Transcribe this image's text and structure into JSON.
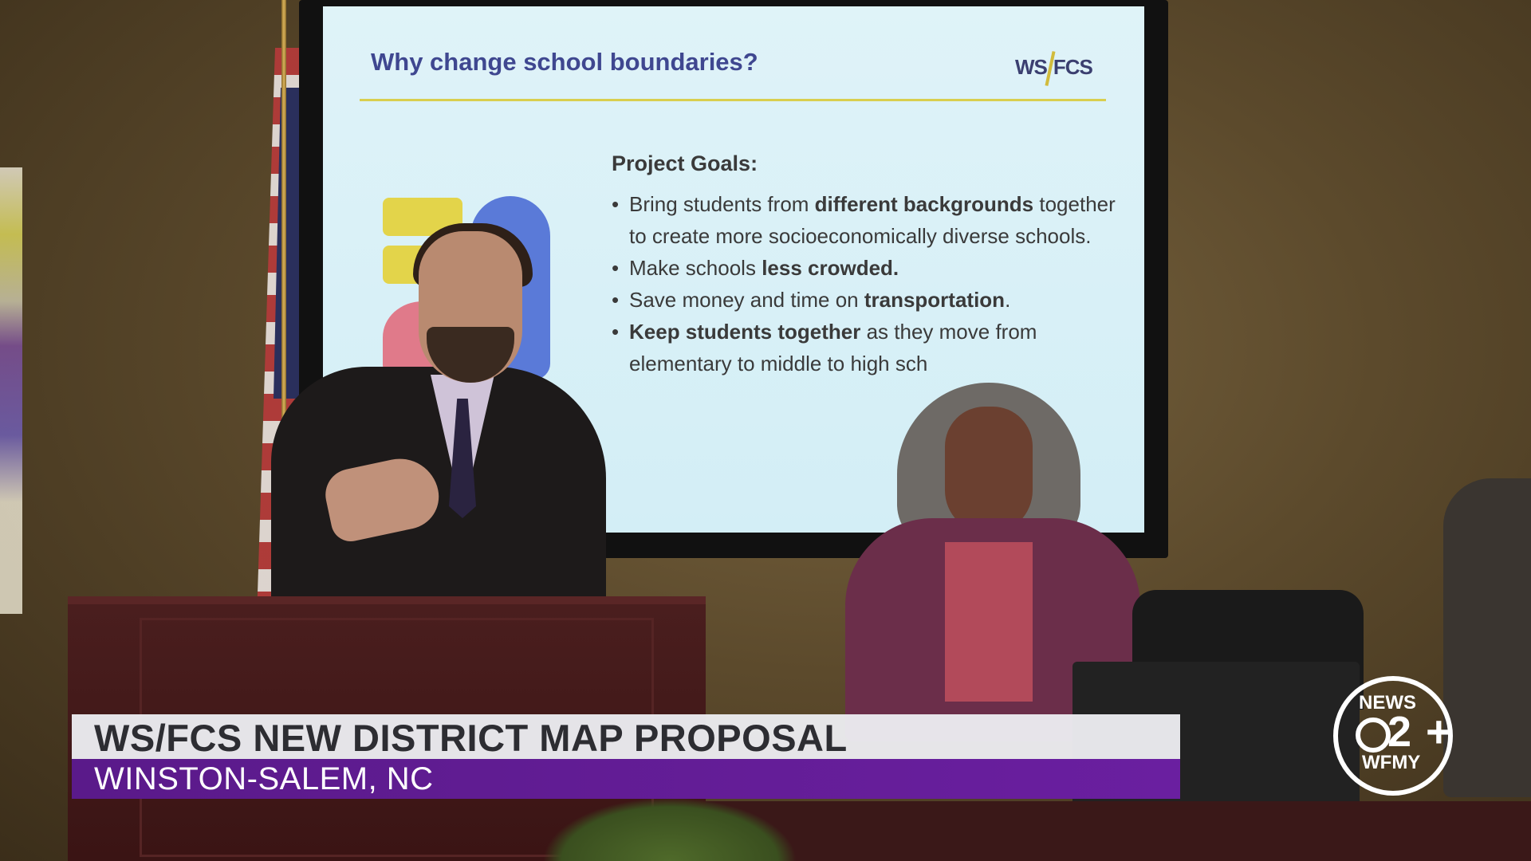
{
  "slide": {
    "title": "Why change school boundaries?",
    "logo_text_left": "WS",
    "logo_text_right": "FCS",
    "goals_heading": "Project Goals:",
    "goals": [
      {
        "pre": "Bring students from ",
        "bold": "different backgrounds",
        "post": " together to create more socioeconomically diverse schools."
      },
      {
        "pre": "Make schools ",
        "bold": "less crowded.",
        "post": ""
      },
      {
        "pre": "Save money and time on ",
        "bold": "transportation",
        "post": "."
      },
      {
        "pre": "",
        "bold": "Keep students together",
        "post": " as they move from elementary to middle to high sch"
      }
    ]
  },
  "lower_third": {
    "headline": "WS/FCS NEW DISTRICT MAP PROPOSAL",
    "location": "WINSTON-SALEM, NC"
  },
  "station_bug": {
    "top": "NEWS",
    "number": "2",
    "plus": "+",
    "callsign": "WFMY"
  },
  "colors": {
    "lower_third_bar": "#6a1fa0",
    "headline_bg": "#ececf0",
    "slide_title": "#3f4790",
    "slide_rule": "#d9cf4e"
  }
}
